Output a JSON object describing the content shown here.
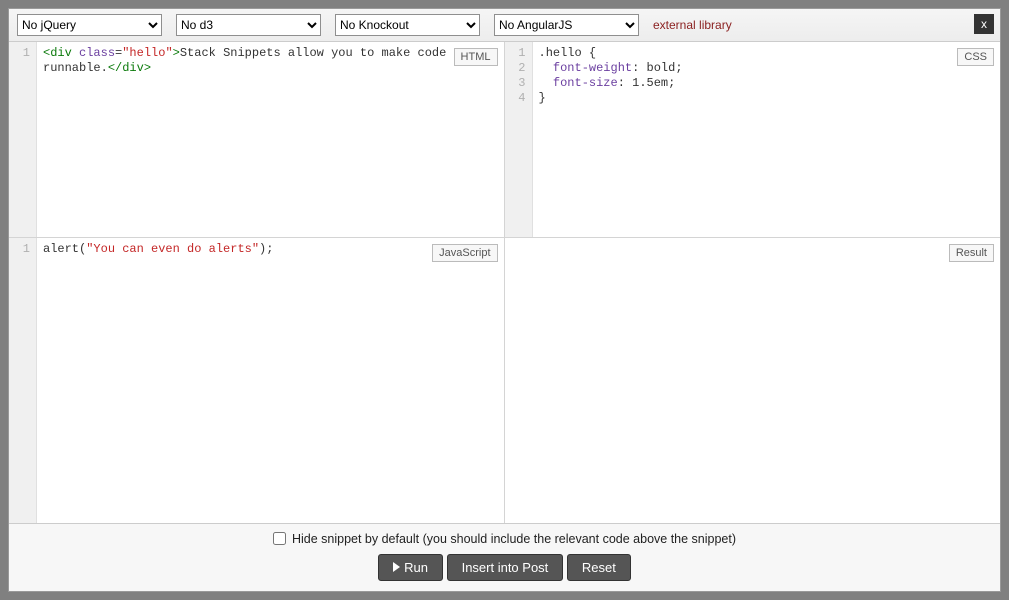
{
  "toolbar": {
    "selects": {
      "jquery": "No jQuery",
      "d3": "No d3",
      "knockout": "No Knockout",
      "angular": "No AngularJS"
    },
    "external_library": "external library",
    "close": "x"
  },
  "panes": {
    "html": {
      "label": "HTML",
      "gutter": [
        "1"
      ],
      "code": {
        "l1a": "<div",
        "l1b": " class",
        "l1c": "=",
        "l1d": "\"hello\"",
        "l1e": ">",
        "l1f": "Stack Snippets allow you to make code\nrunnable.",
        "l1g": "</div>"
      }
    },
    "css": {
      "label": "CSS",
      "gutter": [
        "1",
        "2",
        "3",
        "4"
      ],
      "code": {
        "l1": ".hello {",
        "l2a": "  font-weight",
        "l2b": ": bold;",
        "l3a": "  font-size",
        "l3b": ": 1.5em;",
        "l4": "}"
      }
    },
    "js": {
      "label": "JavaScript",
      "gutter": [
        "1"
      ],
      "code": {
        "l1a": "alert(",
        "l1b": "\"You can even do alerts\"",
        "l1c": ");"
      }
    },
    "result": {
      "label": "Result"
    }
  },
  "footer": {
    "hide_label": "Hide snippet by default (you should include the relevant code above the snippet)",
    "run": "Run",
    "insert": "Insert into Post",
    "reset": "Reset"
  }
}
